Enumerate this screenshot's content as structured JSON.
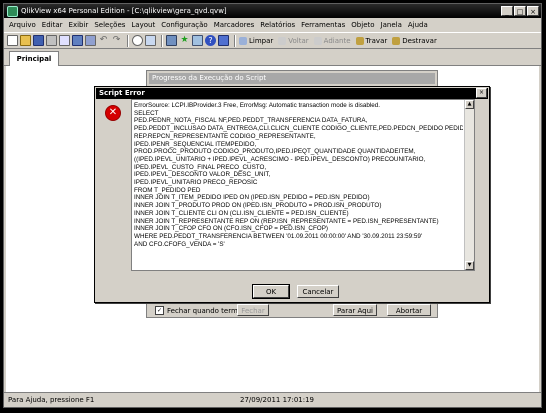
{
  "window": {
    "title": "QlikView x64 Personal Edition - [C:\\qlikview\\gera_qvd.qvw]"
  },
  "menu": [
    "Arquivo",
    "Editar",
    "Exibir",
    "Seleções",
    "Layout",
    "Configuração",
    "Marcadores",
    "Relatórios",
    "Ferramentas",
    "Objeto",
    "Janela",
    "Ajuda"
  ],
  "toolbar": {
    "limpar": "Limpar",
    "voltar": "Voltar",
    "adiante": "Adiante",
    "travar": "Travar",
    "destravar": "Destravar"
  },
  "tabs": {
    "principal": "Principal"
  },
  "progress": {
    "title": "Progresso da Execução do Script",
    "close_when_done": "Fechar quando terminar",
    "fechar": "Fechar",
    "parar_aqui": "Parar Aqui",
    "abortar": "Abortar"
  },
  "error_dialog": {
    "title": "Script Error",
    "message": "ErrorSource: LCPI.IBProvider.3 Free, ErrorMsg: Automatic transaction mode is disabled.\nSELECT\nPED.PEDNR_NOTA_FISCAL NF,PED.PEDDT_TRANSFERENCIA DATA_FATURA,\nPED.PEDDT_INCLUSAO DATA_ENTREGA,CLI.CLICN_CLIENTE CODIGO_CLIENTE,PED.PEDCN_PEDIDO PEDIDO,\nREP.REPCN_REPRESENTANTE CODIGO_REPRESENTANTE,\nIPED.IPENR_SEQUENCIAL ITEMPEDIDO,\nPROD.PROCC_PRODUTO CODIGO_PRODUTO,IPED.IPEQT_QUANTIDADE QUANTIDADEITEM,\n((IPED.IPEVL_UNITARIO + IPED.IPEVL_ACRESCIMO - IPED.IPEVL_DESCONTO) PRECOUNITARIO,\nIPED.IPEVL_CUSTO_FINAL PRECO_CUSTO,\nIPED.IPEVL_DESCONTO VALOR_DESC_UNIT,\nIPED.IPEVL_UNITARIO PRECO_REPOSIC\nFROM T_PEDIDO PED\nINNER JOIN T_ITEM_PEDIDO IPED ON (IPED.ISN_PEDIDO = PED.ISN_PEDIDO)\nINNER JOIN T_PRODUTO PROD ON (IPED.ISN_PRODUTO = PROD.ISN_PRODUTO)\nINNER JOIN T_CLIENTE CLI ON (CLI.ISN_CLIENTE = PED.ISN_CLIENTE)\nINNER JOIN T_REPRESENTANTE REP ON (REP.ISN_REPRESENTANTE = PED.ISN_REPRESENTANTE)\nINNER JOIN T_CFOP CFO ON (CFO.ISN_CFOP = PED.ISN_CFOP)\nWHERE PED.PEDDT_TRANSFERENCIA BETWEEN '01.09.2011 00:00:00' AND '30.09.2011 23:59:59'\nAND CFO.CFOFG_VENDA = 'S'",
    "ok": "OK",
    "cancelar": "Cancelar"
  },
  "status": {
    "left": "Para Ajuda, pressione F1",
    "datetime": "27/09/2011 17:01:19"
  }
}
